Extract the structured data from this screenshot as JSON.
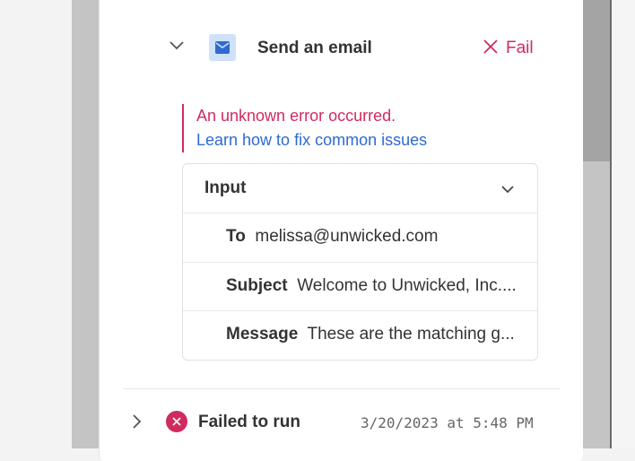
{
  "step": {
    "title": "Send an email",
    "status_label": "Fail",
    "status_color": "#d12b5e",
    "icon": "mail-icon"
  },
  "error": {
    "message": "An unknown error occurred.",
    "link": "Learn how to fix common issues"
  },
  "input_card": {
    "header": "Input",
    "fields": [
      {
        "key": "To",
        "value": "melissa@unwicked.com"
      },
      {
        "key": "Subject",
        "value": "Welcome to Unwicked, Inc...."
      },
      {
        "key": "Message",
        "value": "These are the matching g..."
      }
    ]
  },
  "run": {
    "status_text": "Failed to run",
    "timestamp": "3/20/2023 at 5:48 PM"
  }
}
